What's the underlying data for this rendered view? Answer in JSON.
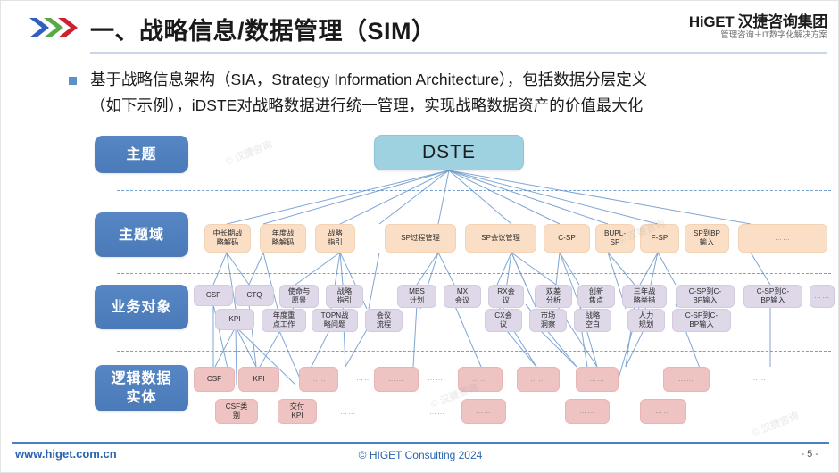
{
  "header": {
    "title": "一、战略信息/数据管理（SIM）",
    "chevron_icon": "double-chevron-icon",
    "logo_main": "HiGET 汉捷咨询集团",
    "logo_sub": "管理咨询＋IT数字化解决方案"
  },
  "bullet": {
    "marker": "square-bullet",
    "line1": "基于战略信息架构（SIA，Strategy Information Architecture），包括数据分层定义",
    "line2": "（如下示例），iDSTE对战略数据进行统一管理，实现战略数据资产的价值最大化"
  },
  "diagram": {
    "levels": [
      {
        "label": "主题"
      },
      {
        "label": "主题域"
      },
      {
        "label": "业务对象"
      },
      {
        "label": "逻辑数据\n实体"
      }
    ],
    "root": {
      "label": "DSTE"
    },
    "domains": [
      {
        "label": "中长期战\n略解码"
      },
      {
        "label": "年度战\n略解码"
      },
      {
        "label": "战略\n指引"
      },
      {
        "label": "SP过程管理"
      },
      {
        "label": "SP会议管理"
      },
      {
        "label": "C-SP"
      },
      {
        "label": "BUPL-\nSP"
      },
      {
        "label": "F-SP"
      },
      {
        "label": "SP到BP\n输入"
      },
      {
        "label": "……"
      }
    ],
    "objects": [
      {
        "label": "CSF"
      },
      {
        "label": "CTQ"
      },
      {
        "label": "使命与\n愿景"
      },
      {
        "label": "战略\n指引"
      },
      {
        "label": "MBS\n计划"
      },
      {
        "label": "MX\n会议"
      },
      {
        "label": "RX会\n议"
      },
      {
        "label": "双差\n分析"
      },
      {
        "label": "创新\n焦点"
      },
      {
        "label": "三年战\n略举措"
      },
      {
        "label": "C-SP到C-\nBP输入"
      },
      {
        "label": "C-SP到C-\nBP输入"
      },
      {
        "label": "……"
      },
      {
        "label": "KPI"
      },
      {
        "label": "年度重\n点工作"
      },
      {
        "label": "TOPN战\n略问题"
      },
      {
        "label": "会议\n流程"
      },
      {
        "label": "CX会\n议"
      },
      {
        "label": "市场\n洞察"
      },
      {
        "label": "战略\n空白"
      },
      {
        "label": "人力\n规划"
      },
      {
        "label": "C-SP到C-\nBP输入"
      }
    ],
    "entities": [
      {
        "label": "CSF"
      },
      {
        "label": "KPI"
      },
      {
        "label": "……"
      },
      {
        "label": "……"
      },
      {
        "label": "……"
      },
      {
        "label": "……"
      },
      {
        "label": "……"
      },
      {
        "label": "……"
      },
      {
        "label": "CSF类\n别"
      },
      {
        "label": "交付\nKPI"
      },
      {
        "label": "……"
      },
      {
        "label": "……"
      },
      {
        "label": "……"
      },
      {
        "label": "……"
      }
    ],
    "loose_placeholders": [
      "……",
      "……",
      "……",
      "……",
      "……"
    ],
    "colors": {
      "level_label": "#4b7ab8",
      "root": "#9ed2e0",
      "domain": "#fadfc6",
      "object": "#ded8e8",
      "entity": "#eec3c2",
      "link": "#7fa6d4",
      "separator": "#5b8fc9"
    }
  },
  "watermarks": [
    "© 汉捷咨询",
    "© 汉捷咨询",
    "© 汉捷咨询",
    "© 汉捷咨询"
  ],
  "footer": {
    "url": "www.higet.com.cn",
    "copyright": "© HIGET Consulting  2024",
    "page": "- 5 -"
  }
}
